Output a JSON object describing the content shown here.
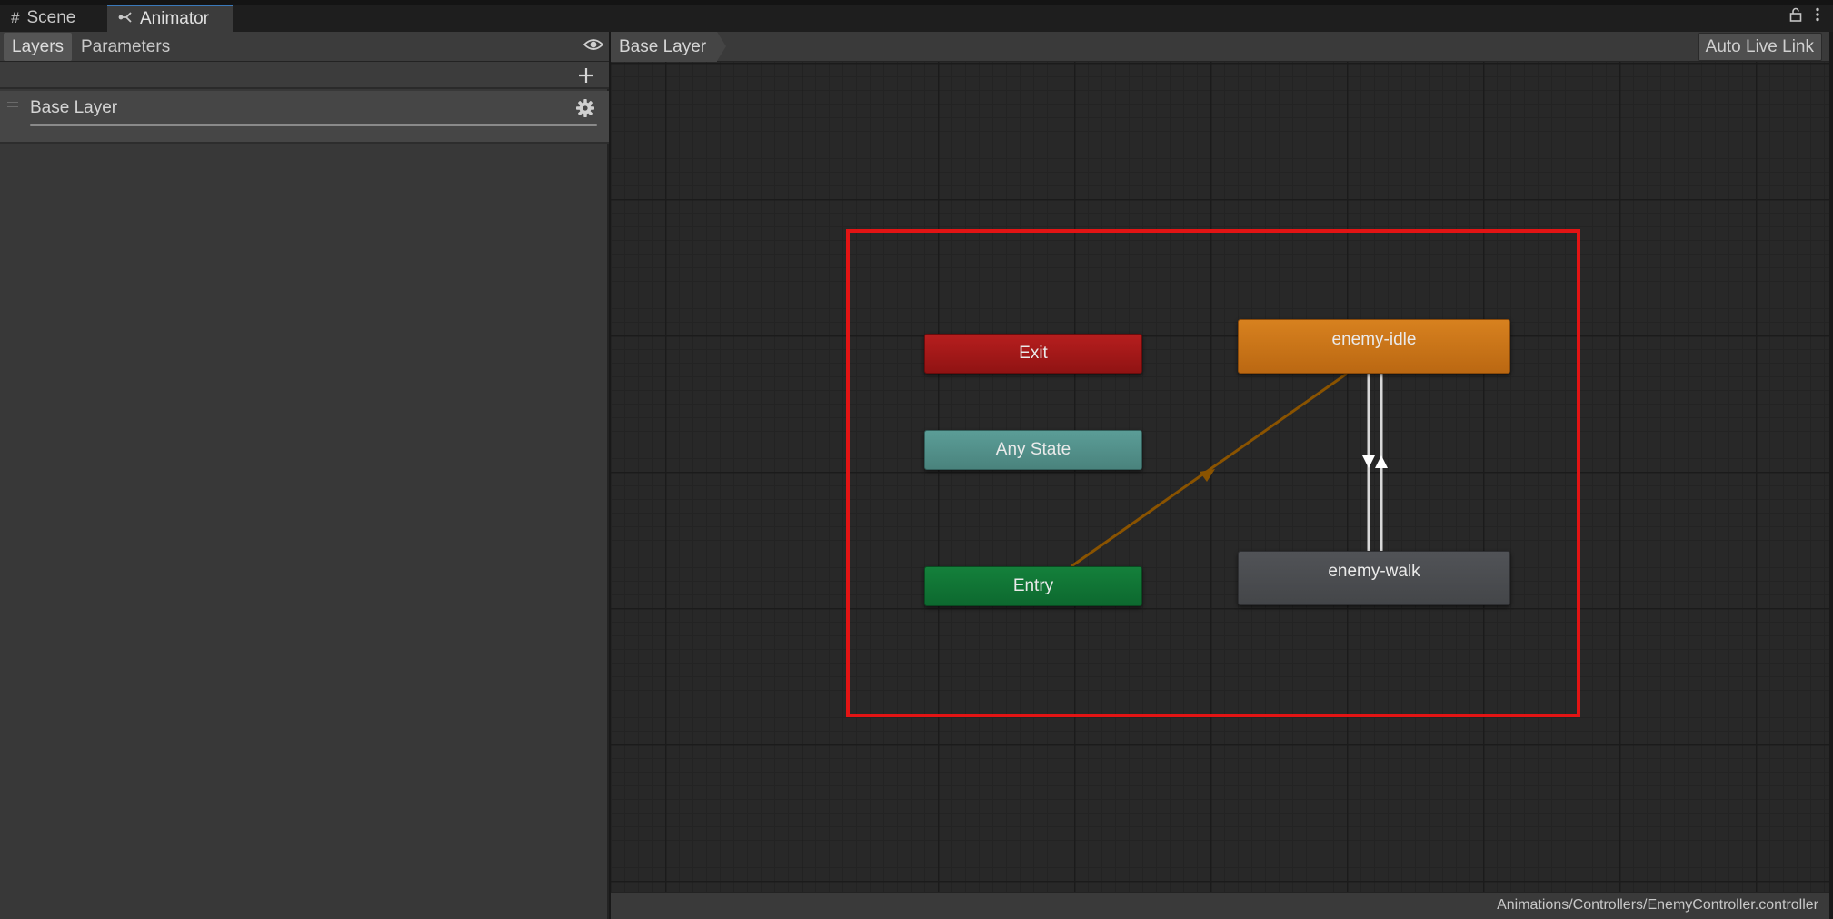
{
  "tabs": {
    "scene": {
      "label": "Scene",
      "icon": "grid-icon"
    },
    "animator": {
      "label": "Animator",
      "icon": "animator-icon"
    }
  },
  "window_tools": {
    "lock_icon": "lock-icon",
    "menu_icon": "kebab-menu-icon"
  },
  "left_panel": {
    "tabs": {
      "layers": "Layers",
      "parameters": "Parameters"
    },
    "visibility_icon": "eye-icon",
    "add_icon": "plus-icon",
    "layers": [
      {
        "name": "Base Layer",
        "settings_icon": "gear-icon"
      }
    ]
  },
  "graph": {
    "breadcrumb": "Base Layer",
    "auto_live_link": "Auto Live Link",
    "states": {
      "exit": "Exit",
      "any_state": "Any State",
      "entry": "Entry",
      "enemy_idle": "enemy-idle",
      "enemy_walk": "enemy-walk"
    },
    "colors": {
      "exit": "#a11818",
      "any_state": "#52908a",
      "entry": "#107534",
      "default_state": "#c97418",
      "state": "#4a4c50",
      "highlight": "#e31414",
      "default_transition": "#8a5300"
    },
    "asset_path": "Animations/Controllers/EnemyController.controller"
  }
}
